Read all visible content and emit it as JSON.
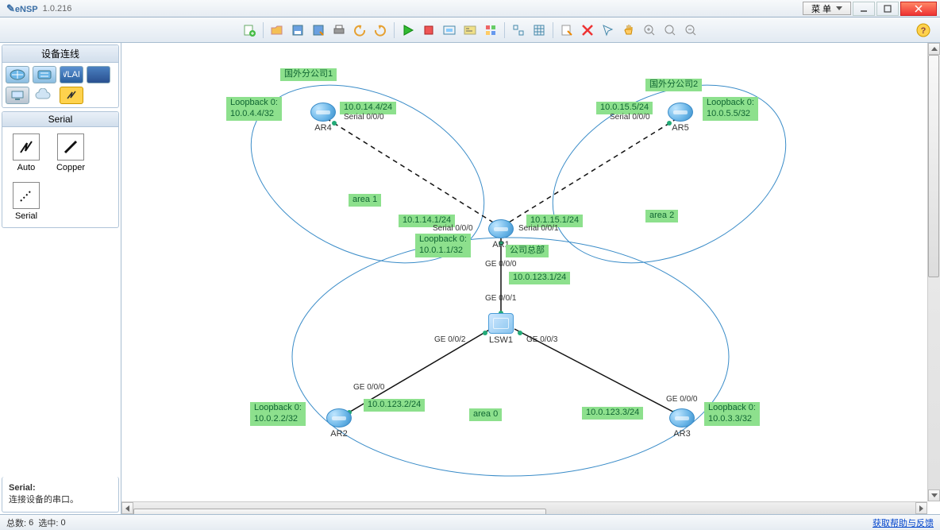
{
  "title": {
    "app": "eNSP",
    "version": "1.0.216"
  },
  "menu": {
    "label": "菜  单"
  },
  "sidebar": {
    "panel1_title": "设备连线",
    "panel2_title": "Serial",
    "tools": {
      "auto": "Auto",
      "copper": "Copper",
      "serial": "Serial"
    },
    "hint_title": "Serial:",
    "hint_body": "连接设备的串口。"
  },
  "status": {
    "total_label": "总数:",
    "total": "6",
    "sel_label": "选中:",
    "sel": "0",
    "help": "获取帮助与反馈"
  },
  "net": {
    "areas": {
      "a0": "area 0",
      "a1": "area 1",
      "a2": "area 2"
    },
    "titles": {
      "c1": "国外分公司1",
      "c2": "国外分公司2",
      "hq": "公司总部"
    },
    "nodes": {
      "ar1": "AR1",
      "ar2": "AR2",
      "ar3": "AR3",
      "ar4": "AR4",
      "ar5": "AR5",
      "lsw1": "LSW1"
    },
    "loop": {
      "ar1": "Loopback 0:\n10.0.1.1/32",
      "ar2": "Loopback 0:\n10.0.2.2/32",
      "ar3": "Loopback 0:\n10.0.3.3/32",
      "ar4": "Loopback 0:\n10.0.4.4/32",
      "ar5": "Loopback 0:\n10.0.5.5/32"
    },
    "ip": {
      "ar4s": "10.0.14.4/24",
      "ar5s": "10.0.15.5/24",
      "ar1s0": "10.1.14.1/24",
      "ar1s1": "10.1.15.1/24",
      "ar1g": "10.0.123.1/24",
      "ar2g": "10.0.123.2/24",
      "ar3g": "10.0.123.3/24"
    },
    "ports": {
      "s000a": "Serial 0/0/0",
      "s000b": "Serial 0/0/0",
      "s000c": "Serial 0/0/0",
      "s001": "Serial 0/0/1",
      "g000a": "GE 0/0/0",
      "g001": "GE 0/0/1",
      "g002": "GE 0/0/2",
      "g003": "GE 0/0/3",
      "g000b": "GE 0/0/0",
      "g000c": "GE 0/0/0"
    }
  }
}
